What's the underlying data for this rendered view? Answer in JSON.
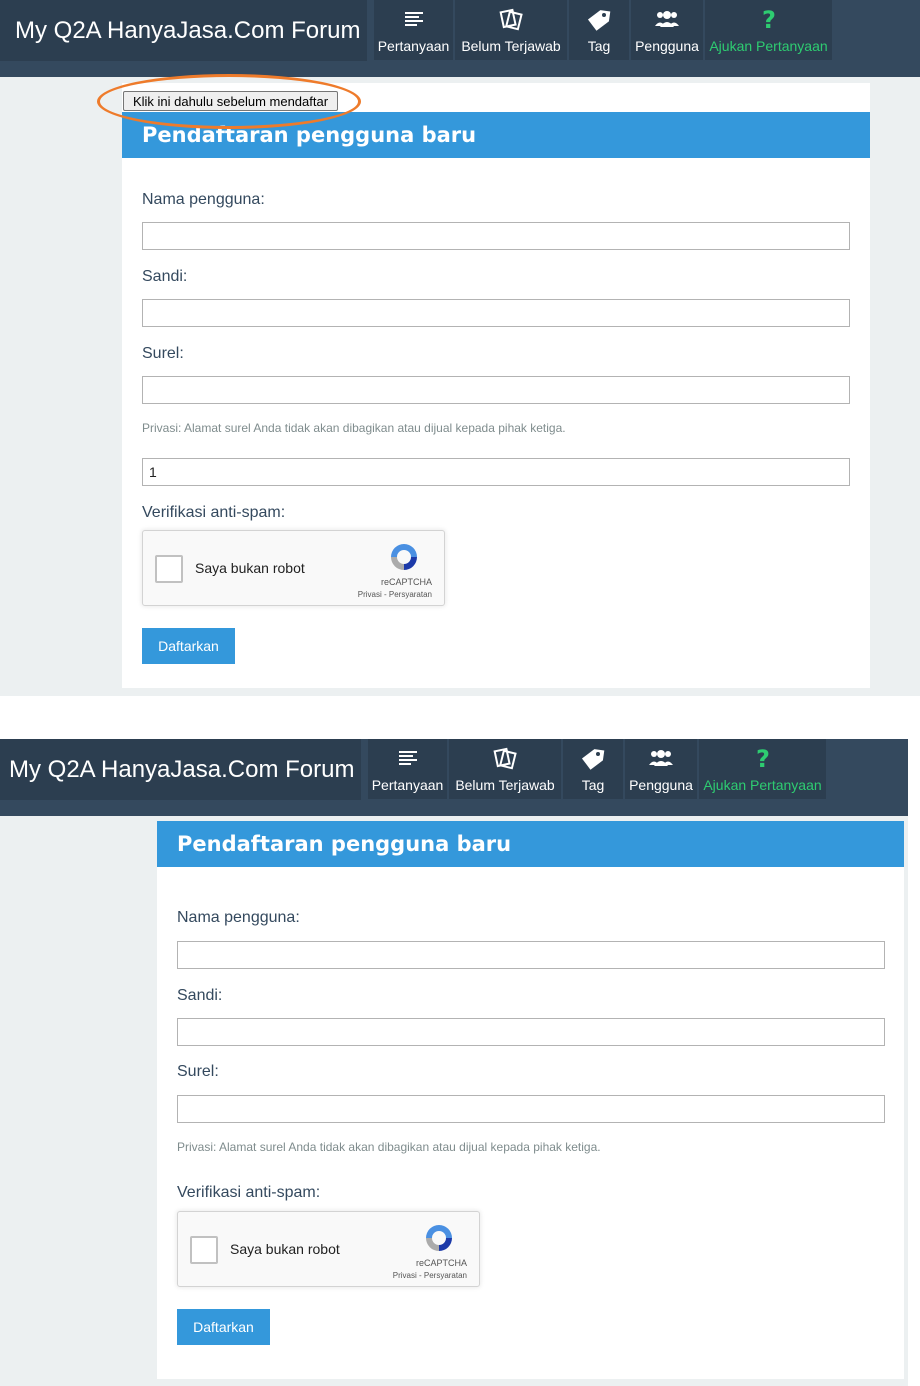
{
  "site": {
    "title": "My Q2A HanyaJasa.Com Forum"
  },
  "nav": [
    {
      "label": "Pertanyaan",
      "icon": "list-icon"
    },
    {
      "label": "Belum Terjawab",
      "icon": "cards-icon"
    },
    {
      "label": "Tag",
      "icon": "tag-icon"
    },
    {
      "label": "Pengguna",
      "icon": "users-icon"
    },
    {
      "label": "Ajukan Pertanyaan",
      "icon": "question-icon"
    }
  ],
  "colors": {
    "topbar": "#34495e",
    "accent": "#3498db",
    "ask": "#2ecc71",
    "highlight": "#ee7b2b"
  },
  "form": {
    "title": "Pendaftaran pengguna baru",
    "username_label": "Nama pengguna:",
    "password_label": "Sandi:",
    "email_label": "Surel:",
    "privacy_note": "Privasi: Alamat surel Anda tidak akan dibagikan atau dijual kepada pihak ketiga.",
    "extra_value": "1",
    "antispam_label": "Verifikasi anti-spam:",
    "captcha_text": "Saya bukan robot",
    "captcha_brand": "reCAPTCHA",
    "captcha_links": "Privasi - Persyaratan",
    "submit": "Daftarkan"
  },
  "pre_button": "Klik ini dahulu sebelum mendaftar"
}
